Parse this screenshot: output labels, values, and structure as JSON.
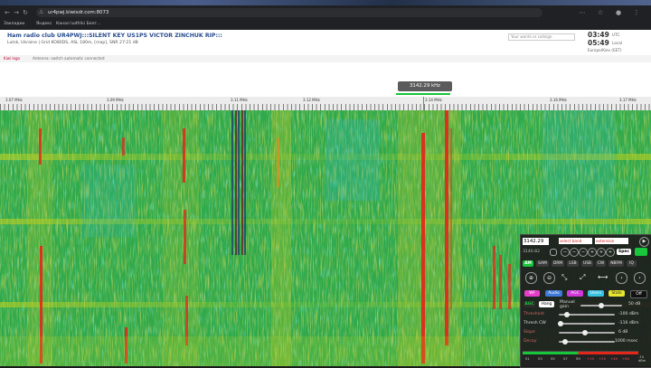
{
  "browser": {
    "url": "ur4pwj.kiwisdr.com:8073",
    "bookmarks": [
      "Закладки",
      "Яндекс",
      "Канал ludfriki Белг..."
    ]
  },
  "header": {
    "title": "Ham radio club UR4PWJ:::SILENT KEY US1PS   VICTOR ZINCHUK   RIP:::",
    "subtitle": "Lutsk, Ukraine | Grid KO80DS, ASL 180m, [map], SNR 27:21 dB",
    "search_placeholder": "Your words or callsign",
    "time_utc": "03:49",
    "time_utc_label": "UTC",
    "time_local": "05:49",
    "time_local_label": "Local",
    "timezone": "Europe/Kiev (EET)"
  },
  "status_bar": {
    "left": "Kiwi logo",
    "text": "Antenna: switch automatic connected"
  },
  "freq_badge": "3142.29 kHz",
  "ruler": {
    "labels": [
      "3.07 MHz",
      "3.09 MHz",
      "3.11 MHz",
      "3.12 MHz",
      "3.14 MHz",
      "3.16 MHz",
      "3.17 MHz"
    ]
  },
  "panel": {
    "freq_value": "3142.29",
    "band_select": "select band",
    "ext_select": "extension",
    "sub_value": "3140.82",
    "step_buttons": [
      "−",
      "−",
      "−",
      "+",
      "+",
      "+"
    ],
    "spec_label": "Spec",
    "modes": [
      "AM",
      "SAM",
      "DRM",
      "LSB",
      "USB",
      "CW",
      "NBFM",
      "IQ"
    ],
    "func_buttons": [
      "WF",
      "Audio",
      "AGC",
      "Users",
      "Stats",
      "Off"
    ],
    "agc_label": "AGC",
    "hang_label": "Hang",
    "manual_label": "Manual gain",
    "gain_value": "50 dB",
    "threshold_label": "Threshold",
    "threshold_value": "-100 dBm",
    "thresh_cw_label": "Thresh CW",
    "thresh_cw_value": "-116 dBm",
    "slope_label": "Slope",
    "slope_value": "6 dB",
    "decay_label": "Decay",
    "decay_value": "1000 msec",
    "smeter_scale": [
      "S1",
      "S3",
      "S5",
      "S7",
      "S9",
      "+10",
      "+20",
      "+40",
      "+60"
    ],
    "smeter_unit": "-74 dBm"
  },
  "colors": {
    "waterfall_base": "#2ea84a",
    "signal_red": "#e5261a",
    "accent_green": "#19c53a",
    "func_wf": "#e63ec8",
    "func_audio": "#3e78d8",
    "func_agc": "#cf38d8",
    "func_users": "#36c3e0",
    "func_stats": "#e6e62e",
    "func_off": "#111111"
  }
}
